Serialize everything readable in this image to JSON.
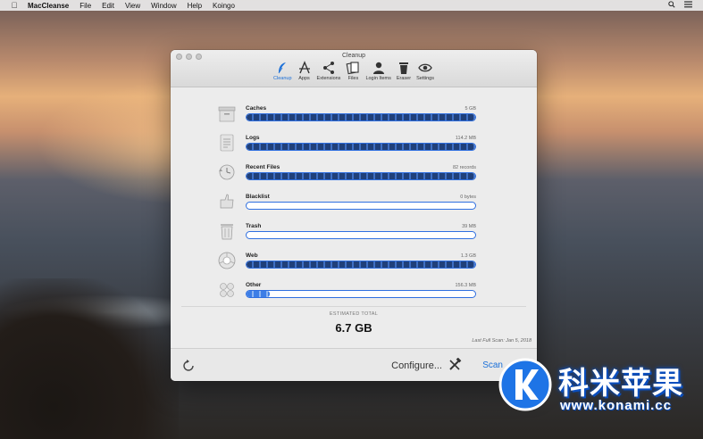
{
  "menubar": {
    "apple": "",
    "app_name": "MacCleanse",
    "items": [
      "File",
      "Edit",
      "View",
      "Window",
      "Help",
      "Koingo"
    ]
  },
  "window": {
    "title": "Cleanup",
    "toolbar": [
      {
        "label": "Cleanup",
        "icon": "feather-icon"
      },
      {
        "label": "Apps",
        "icon": "apps-icon"
      },
      {
        "label": "Extensions",
        "icon": "share-icon"
      },
      {
        "label": "Files",
        "icon": "files-icon"
      },
      {
        "label": "Login Items",
        "icon": "person-icon"
      },
      {
        "label": "Eraser",
        "icon": "trash-icon"
      },
      {
        "label": "Settings",
        "icon": "eye-icon"
      }
    ],
    "categories": [
      {
        "name": "Caches",
        "size": "5 GB",
        "fill": 1.0,
        "icon": "caches-icon"
      },
      {
        "name": "Logs",
        "size": "114.2 MB",
        "fill": 1.0,
        "icon": "logs-icon"
      },
      {
        "name": "Recent Files",
        "size": "82 records",
        "fill": 1.0,
        "icon": "recent-files-icon"
      },
      {
        "name": "Blacklist",
        "size": "0 bytes",
        "fill": 0.0,
        "icon": "blacklist-icon"
      },
      {
        "name": "Trash",
        "size": "39 MB",
        "fill": 0.0,
        "icon": "trash-bin-icon"
      },
      {
        "name": "Web",
        "size": "1.3 GB",
        "fill": 1.0,
        "icon": "web-icon"
      },
      {
        "name": "Other",
        "size": "156.3 MB",
        "fill": 0.1,
        "icon": "other-icon"
      }
    ],
    "total_label": "ESTIMATED TOTAL",
    "total_value": "6.7 GB",
    "last_scan": "Last Full Scan: Jan 5, 2018",
    "configure_label": "Configure...",
    "scan_label": "Scan"
  },
  "watermark": {
    "text": "科米苹果",
    "url": "www.konami.cc"
  },
  "colors": {
    "accent": "#1a6fd8",
    "bar_border": "#2f6fe0",
    "bar_fill": "#20407a"
  }
}
